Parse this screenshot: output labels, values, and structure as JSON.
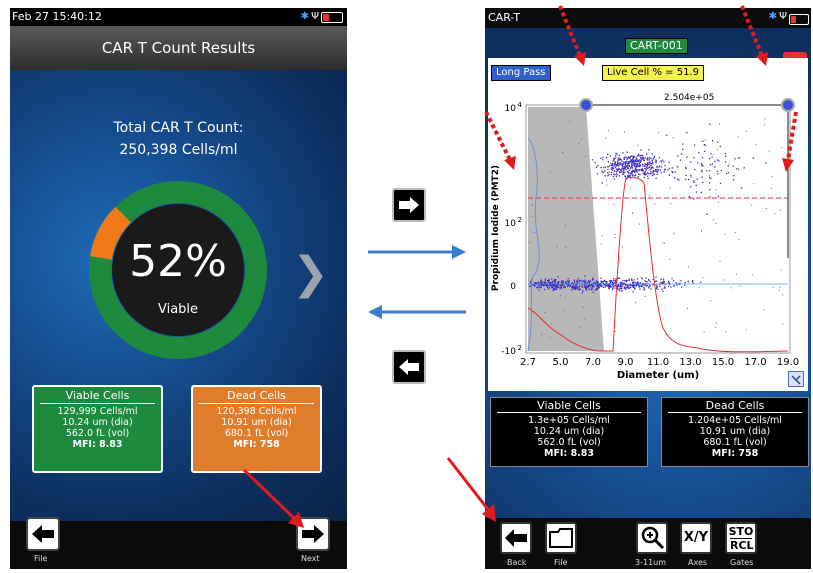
{
  "left": {
    "status_time": "Feb 27 15:40:12",
    "title": "CAR T Count Results",
    "total_label": "Total CAR T Count:",
    "total_value": "250,398 Cells/ml",
    "gauge": {
      "percent_label": "52%",
      "caption": "Viable",
      "viable_fraction": 0.52,
      "color_viable": "#1e8a3e",
      "color_dead": "#f07a1a"
    },
    "viable_card": {
      "title": "Viable Cells",
      "count": "129,999 Cells/ml",
      "diameter": "10.24 um (dia)",
      "volume": "562.0 fL (vol)",
      "mfi": "MFI:  8.83",
      "color": "#1e8a3e"
    },
    "dead_card": {
      "title": "Dead Cells",
      "count": "120,398 Cells/ml",
      "diameter": "10.91 um (dia)",
      "volume": "680.1 fL (vol)",
      "mfi": "MFI:   758",
      "color": "#e07d2c"
    },
    "bottom": {
      "file_label": "File",
      "next_label": "Next"
    }
  },
  "right": {
    "app_title": "CAR-T",
    "sample_tag": "CART-001",
    "filter_tag": "Long Pass",
    "live_cell_tag": "Live Cell % = 51.9",
    "gate_value": "2.504e+05",
    "plot": {
      "x_label": "Diameter (um)",
      "y_label": "Propidium Iodide (PMT2)",
      "x_ticks": [
        "2.7",
        "5.0",
        "7.0",
        "9.0",
        "11.0",
        "13.0",
        "15.0",
        "17.0",
        "19.0"
      ],
      "y_ticks": [
        "10",
        "10",
        "0",
        "-10"
      ],
      "y_tick_exps": [
        "4",
        "2",
        "",
        "2"
      ]
    },
    "viable_card": {
      "title": "Viable Cells",
      "count": "1.3e+05 Cells/ml",
      "diameter": "10.24 um (dia)",
      "volume": "562.0 fL (vol)",
      "mfi": "MFI:  8.83"
    },
    "dead_card": {
      "title": "Dead Cells",
      "count": "1.204e+05 Cells/ml",
      "diameter": "10.91 um (dia)",
      "volume": "680.1 fL (vol)",
      "mfi": "MFI:   758"
    },
    "toolbar": {
      "back_label": "Back",
      "file_label": "File",
      "zoom_label": "3-11um",
      "axes_label": "Axes",
      "axes_text": "X/Y",
      "gates_label": "Gates",
      "gates_text_top": "STO",
      "gates_text_bottom": "RCL"
    }
  },
  "colors": {
    "annotation_red": "#e01b1b",
    "transition_arrow": "#3d7cc9"
  }
}
